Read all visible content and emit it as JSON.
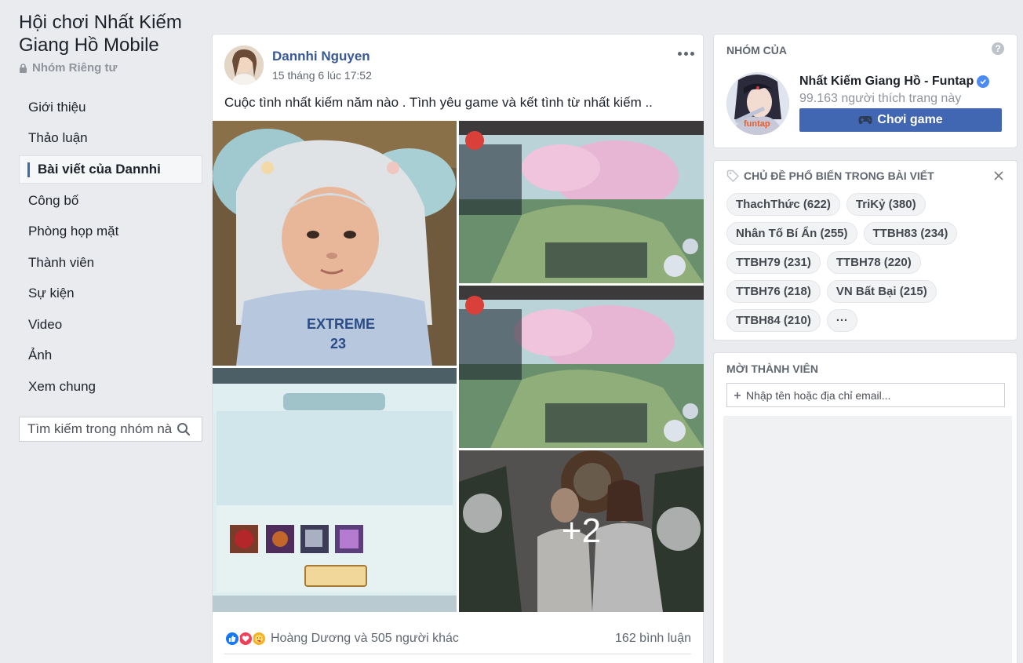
{
  "sidebar": {
    "group_name": "Hội chơi Nhất Kiếm Giang Hồ Mobile",
    "privacy_label": "Nhóm Riêng tư",
    "items": [
      {
        "label": "Giới thiệu"
      },
      {
        "label": "Thảo luận"
      },
      {
        "label": "Bài viết của Dannhi",
        "active": true
      },
      {
        "label": "Công bố"
      },
      {
        "label": "Phòng họp mặt"
      },
      {
        "label": "Thành viên"
      },
      {
        "label": "Sự kiện"
      },
      {
        "label": "Video"
      },
      {
        "label": "Ảnh"
      },
      {
        "label": "Xem chung"
      }
    ],
    "search_placeholder": "Tìm kiếm trong nhóm này"
  },
  "post": {
    "author": "Dannhi Nguyen",
    "timestamp": "15 tháng 6 lúc 17:52",
    "text": "Cuộc tình nhất kiếm năm nào . Tình yêu game và kết tình từ nhất kiếm ..",
    "extra_photos": "+2",
    "reactions_text": "Hoàng Dương và 505 người khác",
    "comments_text": "162 bình luận"
  },
  "right": {
    "page_card": {
      "heading": "NHÓM CỦA",
      "page_name": "Nhất Kiếm Giang Hồ - Funtap",
      "likes": "99.163 người thích trang này",
      "button": "Chơi game",
      "logo_text": "funtap",
      "help": "?"
    },
    "topics": {
      "heading": "CHỦ ĐỀ PHỔ BIẾN TRONG BÀI VIẾT",
      "tags": [
        "ThachThức (622)",
        "TriKỷ (380)",
        "Nhân Tố Bí Ẩn (255)",
        "TTBH83 (234)",
        "TTBH79 (231)",
        "TTBH78 (220)",
        "TTBH76 (218)",
        "VN Bất Bại (215)",
        "TTBH84 (210)",
        "···"
      ]
    },
    "invite": {
      "heading": "MỜI THÀNH VIÊN",
      "placeholder": "Nhập tên hoặc địa chỉ email..."
    }
  },
  "colors": {
    "accent": "#4267b2",
    "link": "#385898",
    "background": "#e9ebee"
  }
}
